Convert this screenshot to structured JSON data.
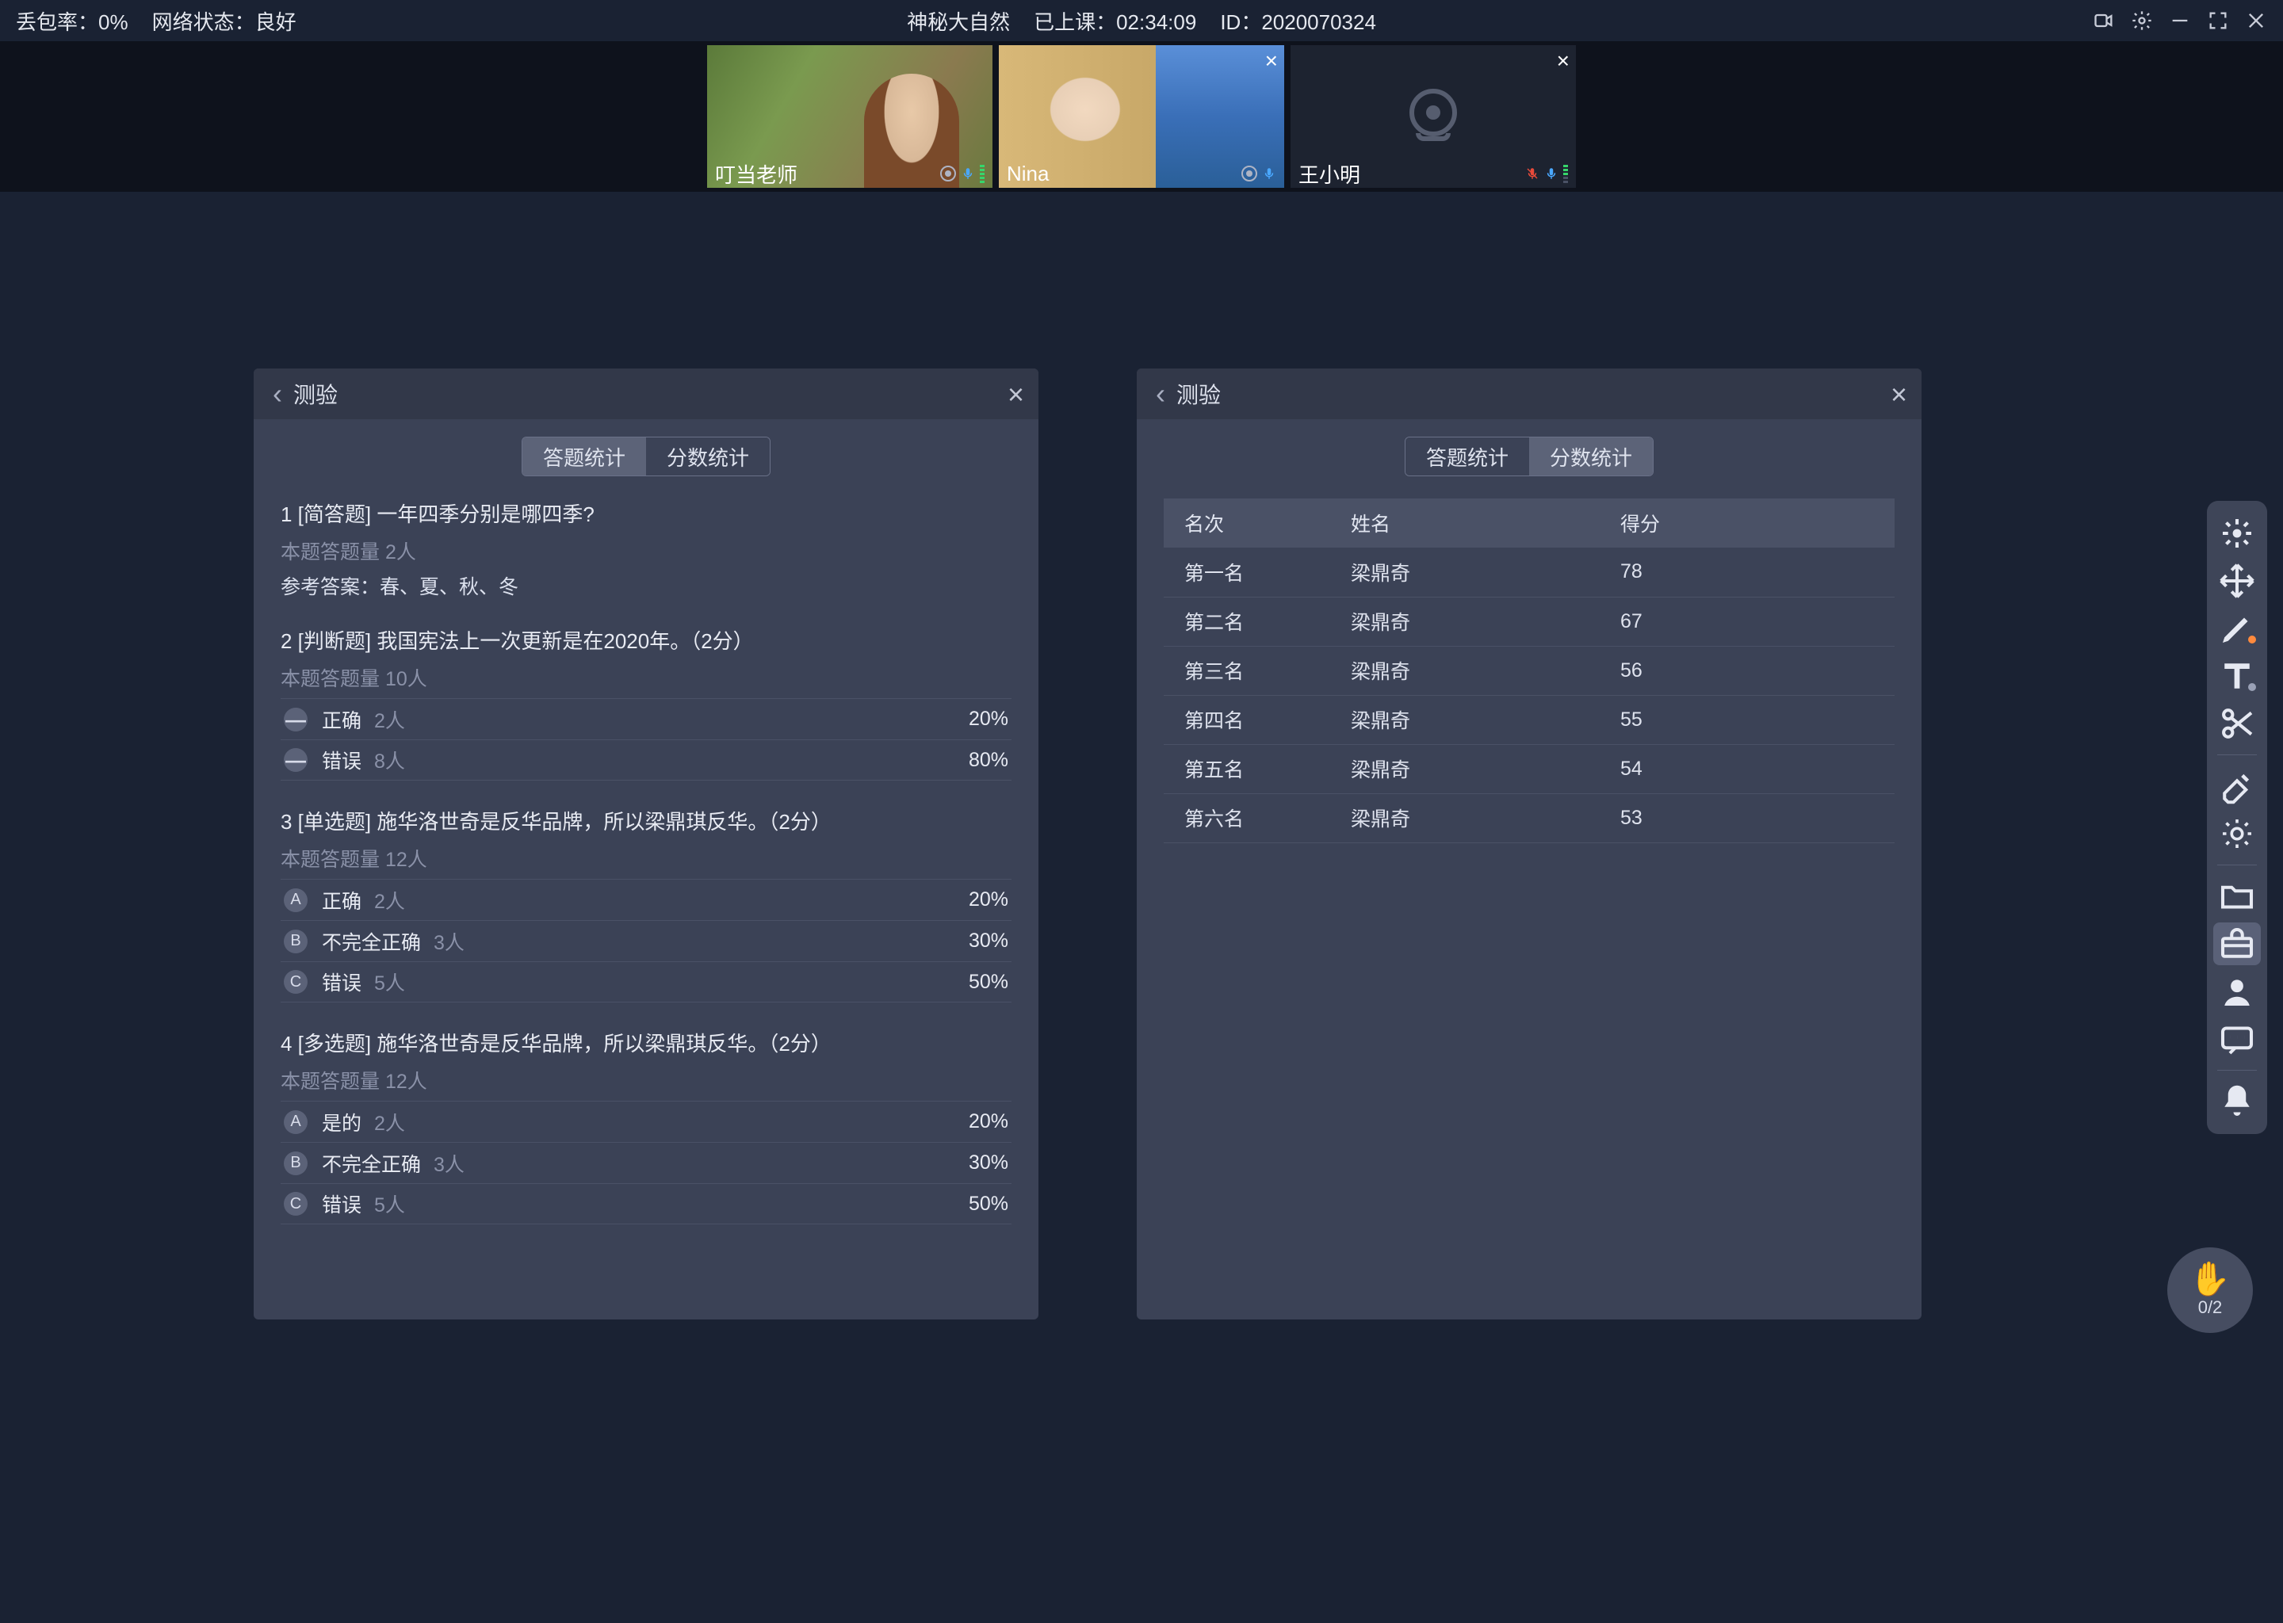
{
  "topbar": {
    "loss_rate_label": "丢包率：",
    "loss_rate_value": "0%",
    "net_label": "网络状态：",
    "net_value": "良好",
    "course_title": "神秘大自然",
    "duration_label": "已上课：",
    "duration_value": "02:34:09",
    "id_label": "ID：",
    "id_value": "2020070324"
  },
  "videos": {
    "t1_name": "叮当老师",
    "t2_name": "Nina",
    "t3_name": "王小明"
  },
  "panel": {
    "title": "测验",
    "tab_answer": "答题统计",
    "tab_score": "分数统计"
  },
  "questions": [
    {
      "title": "1 [简答题] 一年四季分别是哪四季?",
      "sub": "本题答题量 2人",
      "ref": "参考答案：春、夏、秋、冬",
      "opts": []
    },
    {
      "title": "2 [判断题] 我国宪法上一次更新是在2020年。（2分）",
      "sub": "本题答题量 10人",
      "opts": [
        {
          "badge": "—",
          "dash": true,
          "text": "正确",
          "count": "2人",
          "pct": "20%"
        },
        {
          "badge": "—",
          "dash": true,
          "text": "错误",
          "count": "8人",
          "pct": "80%"
        }
      ]
    },
    {
      "title": "3 [单选题] 施华洛世奇是反华品牌，所以梁鼎琪反华。（2分）",
      "sub": "本题答题量 12人",
      "opts": [
        {
          "badge": "A",
          "text": "正确",
          "count": "2人",
          "pct": "20%"
        },
        {
          "badge": "B",
          "text": "不完全正确",
          "count": "3人",
          "pct": "30%"
        },
        {
          "badge": "C",
          "text": "错误",
          "count": "5人",
          "pct": "50%"
        }
      ]
    },
    {
      "title": "4 [多选题] 施华洛世奇是反华品牌，所以梁鼎琪反华。（2分）",
      "sub": "本题答题量 12人",
      "opts": [
        {
          "badge": "A",
          "text": "是的",
          "count": "2人",
          "pct": "20%"
        },
        {
          "badge": "B",
          "text": "不完全正确",
          "count": "3人",
          "pct": "30%"
        },
        {
          "badge": "C",
          "text": "错误",
          "count": "5人",
          "pct": "50%"
        }
      ]
    }
  ],
  "score_table": {
    "headers": {
      "rank": "名次",
      "name": "姓名",
      "score": "得分"
    },
    "rows": [
      {
        "rank": "第一名",
        "name": "梁鼎奇",
        "score": "78"
      },
      {
        "rank": "第二名",
        "name": "梁鼎奇",
        "score": "67"
      },
      {
        "rank": "第三名",
        "name": "梁鼎奇",
        "score": "56"
      },
      {
        "rank": "第四名",
        "name": "梁鼎奇",
        "score": "55"
      },
      {
        "rank": "第五名",
        "name": "梁鼎奇",
        "score": "54"
      },
      {
        "rank": "第六名",
        "name": "梁鼎奇",
        "score": "53"
      }
    ]
  },
  "fab": {
    "count": "0/2"
  }
}
